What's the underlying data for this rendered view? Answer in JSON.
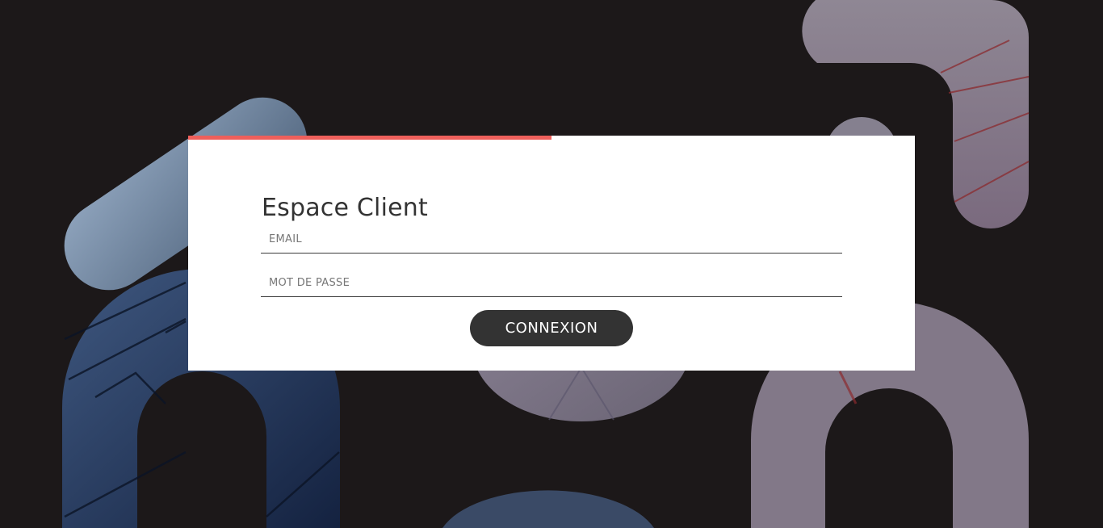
{
  "page": {
    "background_color": "#1c1819",
    "accent_color": "#ee5f5b"
  },
  "progress": {
    "fraction": 0.5
  },
  "login": {
    "title": "Espace Client",
    "email_placeholder": "EMAIL",
    "password_placeholder": "MOT DE PASSE",
    "submit_label": "CONNEXION"
  }
}
